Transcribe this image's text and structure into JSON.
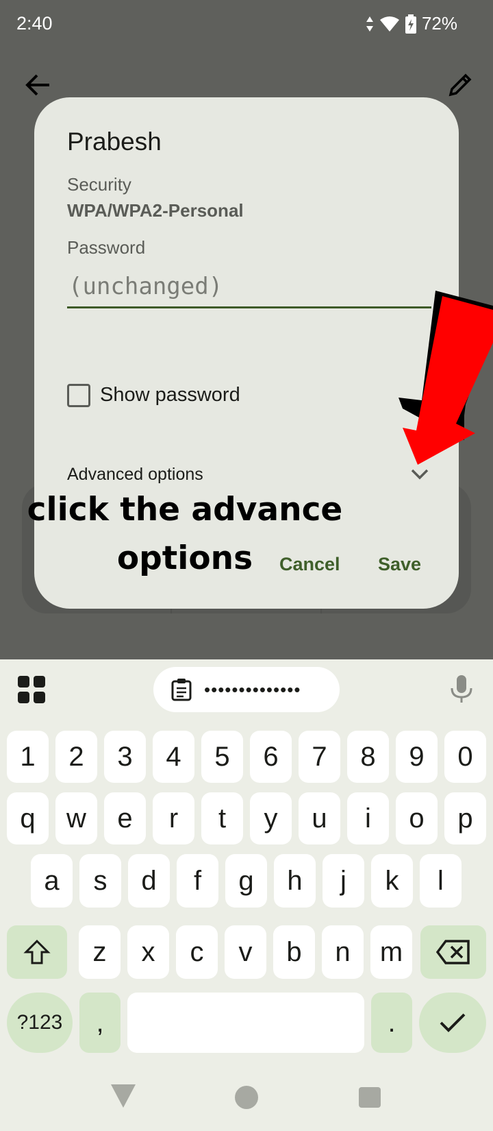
{
  "status_bar": {
    "time": "2:40",
    "battery": "72%"
  },
  "dialog": {
    "title": "Prabesh",
    "security_label": "Security",
    "security_value": "WPA/WPA2-Personal",
    "password_label": "Password",
    "password_placeholder": "(unchanged)",
    "show_password_label": "Show password",
    "advanced_options_label": "Advanced options",
    "cancel_label": "Cancel",
    "save_label": "Save"
  },
  "annotation": {
    "line1": "click the advance",
    "line2": "options",
    "arrow_color": "#ff0000"
  },
  "keyboard": {
    "clipboard_preview": "••••••••••••••",
    "row_numbers": [
      "1",
      "2",
      "3",
      "4",
      "5",
      "6",
      "7",
      "8",
      "9",
      "0"
    ],
    "row_q": [
      "q",
      "w",
      "e",
      "r",
      "t",
      "y",
      "u",
      "i",
      "o",
      "p"
    ],
    "row_a": [
      "a",
      "s",
      "d",
      "f",
      "g",
      "h",
      "j",
      "k",
      "l"
    ],
    "row_z": [
      "z",
      "x",
      "c",
      "v",
      "b",
      "n",
      "m"
    ],
    "symbols_label": "?123",
    "comma_label": ",",
    "period_label": "."
  },
  "colors": {
    "accent": "#3f5f2a",
    "keyboard_mod": "#d4e6c8",
    "dialog_bg": "#e6e8e1"
  }
}
